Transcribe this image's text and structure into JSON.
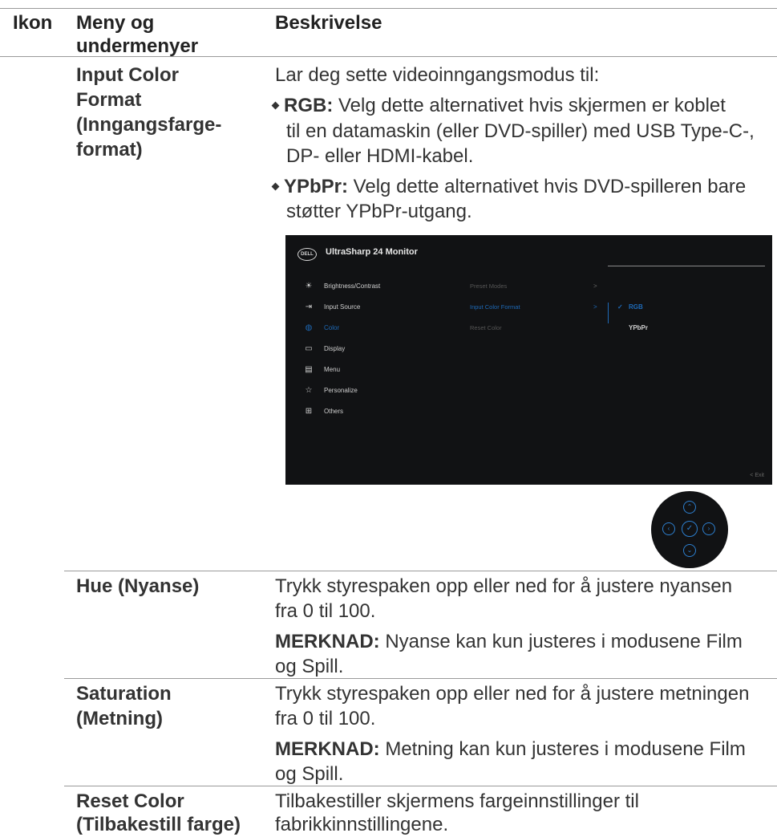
{
  "header": {
    "col_icon": "Ikon",
    "col_menu_line1": "Meny og",
    "col_menu_line2": "undermenyer",
    "col_desc": "Beskrivelse"
  },
  "rows": {
    "input_color": {
      "menu_lines": [
        "Input Color",
        "Format",
        "(Inngangsfarge-",
        "format)"
      ],
      "intro": "Lar deg sette videoinngangsmodus til:",
      "rgb_label": "RGB:",
      "rgb_line1": " Velg dette alternativet hvis skjermen er koblet",
      "rgb_line2": "til en datamaskin (eller DVD-spiller) med USB Type-C-,",
      "rgb_line3": "DP- eller HDMI-kabel.",
      "ypbpr_label": "YPbPr:",
      "ypbpr_line1": " Velg dette alternativet hvis DVD-spilleren bare",
      "ypbpr_line2": "støtter YPbPr-utgang."
    },
    "hue": {
      "menu": "Hue (Nyanse)",
      "desc_line1": "Trykk styrespaken opp eller ned for å justere nyansen",
      "desc_line2": "fra 0 til 100.",
      "note_label": "MERKNAD:",
      "note_line1": " Nyanse kan kun justeres i modusene Film",
      "note_line2": "og Spill."
    },
    "saturation": {
      "menu_line1": "Saturation",
      "menu_line2": "(Metning)",
      "desc_line1": "Trykk styrespaken opp eller ned for å justere metningen",
      "desc_line2": "fra 0 til 100.",
      "note_label": "MERKNAD:",
      "note_line1": " Metning kan kun justeres i modusene Film",
      "note_line2": "og Spill."
    },
    "reset": {
      "menu_line1": "Reset Color",
      "menu_line2": "(Tilbakestill farge)",
      "desc_line1": "Tilbakestiller skjermens fargeinnstillinger til",
      "desc_line2": "fabrikkinnstillingene."
    }
  },
  "osd": {
    "logo": "DELL",
    "title": "UltraSharp 24 Monitor",
    "menu_items": [
      {
        "label": "Brightness/Contrast",
        "icon": "sun-icon"
      },
      {
        "label": "Input Source",
        "icon": "input-icon"
      },
      {
        "label": "Color",
        "icon": "palette-icon"
      },
      {
        "label": "Display",
        "icon": "monitor-icon"
      },
      {
        "label": "Menu",
        "icon": "menu-icon"
      },
      {
        "label": "Personalize",
        "icon": "star-icon"
      },
      {
        "label": "Others",
        "icon": "others-icon"
      }
    ],
    "sub_items": [
      "Preset Modes",
      "Input Color Format",
      "Reset Color"
    ],
    "options": [
      "RGB",
      "YPbPr"
    ],
    "check": "✓",
    "arrow": ">",
    "exit": "< Exit",
    "colors": {
      "background": "#111214",
      "accent": "#1e6ab8"
    }
  }
}
